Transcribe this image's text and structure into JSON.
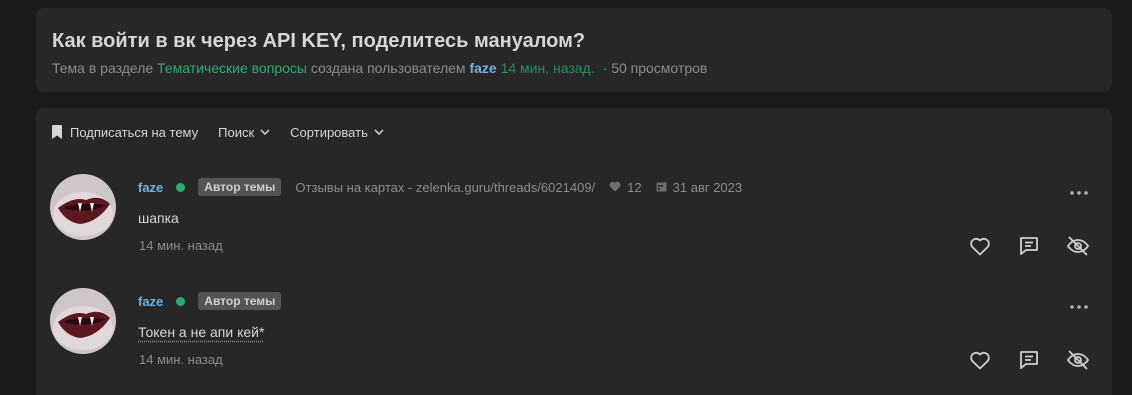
{
  "thread": {
    "title": "Как войти в вк через API KEY, поделитесь мануалом?",
    "meta_prefix": "Тема в разделе",
    "section": "Тематические вопросы",
    "created_by": "создана пользователем",
    "author": "faze",
    "time": "14 мин. назад.",
    "views": "50 просмотров"
  },
  "toolbar": {
    "subscribe_label": "Подписаться на тему",
    "search_label": "Поиск",
    "sort_label": "Сортировать"
  },
  "posts": [
    {
      "username": "faze",
      "badge": "Автор темы",
      "status_text": "Отзывы на картах - zelenka.guru/threads/6021409/",
      "likes": "12",
      "reg_date": "31 авг 2023",
      "text": "шапка",
      "time": "14 мин. назад"
    },
    {
      "username": "faze",
      "badge": "Автор темы",
      "text": "Токен а не апи кей*",
      "time": "14 мин. назад"
    }
  ],
  "colors": {
    "background": "#1b1b1b",
    "card": "#272727",
    "accent_green": "#2bad72",
    "link_blue": "#6db2e0",
    "muted": "#8c8c8c"
  },
  "icons": {
    "toolbar": [
      "bookmark-icon",
      "chevron-down-icon"
    ],
    "post_actions": [
      "heart-icon",
      "reply-quote-icon",
      "eye-off-icon",
      "more-dots-icon"
    ],
    "post_meta": [
      "heart-small-icon",
      "calendar-icon"
    ]
  }
}
